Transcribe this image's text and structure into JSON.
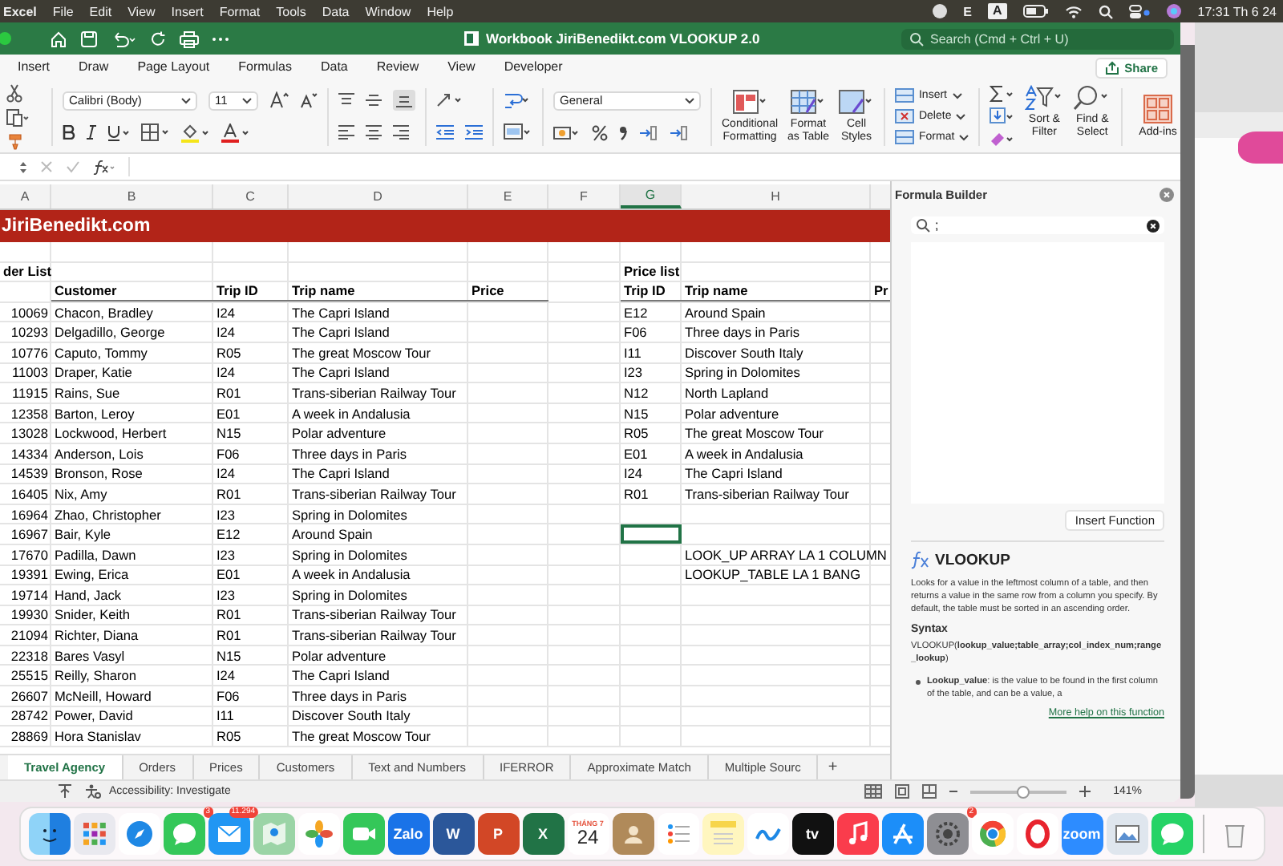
{
  "menu_bar": {
    "app": "Excel",
    "items": [
      "File",
      "Edit",
      "View",
      "Insert",
      "Format",
      "Tools",
      "Data",
      "Window",
      "Help"
    ],
    "status_items": [
      {
        "kind": "plain",
        "text": "E"
      },
      {
        "kind": "boxed",
        "text": "A"
      }
    ],
    "clock": "17:31 Th 6 24"
  },
  "window": {
    "title": "Workbook JiriBenedikt.com VLOOKUP 2.0",
    "search": {
      "placeholder": "Search (Cmd + Ctrl + U)"
    }
  },
  "ribbon": {
    "tabs": [
      {
        "label": "Insert",
        "selected": false
      },
      {
        "label": "Draw",
        "selected": false
      },
      {
        "label": "Page Layout",
        "selected": false
      },
      {
        "label": "Formulas",
        "selected": false
      },
      {
        "label": "Data",
        "selected": false
      },
      {
        "label": "Review",
        "selected": false
      },
      {
        "label": "View",
        "selected": false
      },
      {
        "label": "Developer",
        "selected": false
      }
    ],
    "share": "Share",
    "font": {
      "name": "Calibri (Body)",
      "size": "11"
    },
    "number_format": "General",
    "styles": [
      "Conditional\nFormatting",
      "Format\nas Table",
      "Cell\nStyles"
    ],
    "cells": [
      "Insert",
      "Delete",
      "Format"
    ],
    "editing": [
      "Sort &\nFilter",
      "Find &\nSelect"
    ],
    "add_ins": "Add-ins"
  },
  "sheet": {
    "columns": [
      {
        "label": "A",
        "selected": false
      },
      {
        "label": "B",
        "selected": false
      },
      {
        "label": "C",
        "selected": false
      },
      {
        "label": "D",
        "selected": false
      },
      {
        "label": "E",
        "selected": false
      },
      {
        "label": "F",
        "selected": false
      },
      {
        "label": "G",
        "selected": true
      },
      {
        "label": "H",
        "selected": false
      }
    ],
    "rows": [
      {
        "kind": "banner",
        "text": "JiriBenedikt.com",
        "selected": false
      },
      {
        "kind": "blank",
        "selected": false
      },
      {
        "kind": "title",
        "cells": {
          "A": "der List",
          "G": "Price list"
        },
        "selected": false
      },
      {
        "kind": "header",
        "cells": {
          "B": "Customer",
          "C": "Trip ID",
          "D": "Trip name",
          "E": "Price",
          "G": "Trip ID",
          "H": "Trip name",
          "I": "Pr"
        },
        "selected": false
      },
      {
        "kind": "data",
        "cells": {
          "A": "10069",
          "B": "Chacon, Bradley",
          "C": "I24",
          "D": "The Capri Island",
          "G": "E12",
          "H": "Around Spain"
        },
        "selected": false
      },
      {
        "kind": "data",
        "cells": {
          "A": "10293",
          "B": "Delgadillo, George",
          "C": "I24",
          "D": "The Capri Island",
          "G": "F06",
          "H": "Three days in Paris"
        },
        "selected": false
      },
      {
        "kind": "data",
        "cells": {
          "A": "10776",
          "B": "Caputo, Tommy",
          "C": "R05",
          "D": "The great Moscow Tour",
          "G": "I11",
          "H": "Discover South Italy"
        },
        "selected": false
      },
      {
        "kind": "data",
        "cells": {
          "A": "11003",
          "B": "Draper, Katie",
          "C": "I24",
          "D": "The Capri Island",
          "G": "I23",
          "H": "Spring in Dolomites"
        },
        "selected": false
      },
      {
        "kind": "data",
        "cells": {
          "A": "11915",
          "B": "Rains, Sue",
          "C": "R01",
          "D": "Trans-siberian Railway Tour",
          "G": "N12",
          "H": "North Lapland"
        },
        "selected": false
      },
      {
        "kind": "data",
        "cells": {
          "A": "12358",
          "B": "Barton, Leroy",
          "C": "E01",
          "D": "A week in Andalusia",
          "G": "N15",
          "H": "Polar adventure"
        },
        "selected": false
      },
      {
        "kind": "data",
        "cells": {
          "A": "13028",
          "B": "Lockwood, Herbert",
          "C": "N15",
          "D": "Polar adventure",
          "G": "R05",
          "H": "The great Moscow Tour"
        },
        "selected": false
      },
      {
        "kind": "data",
        "cells": {
          "A": "14334",
          "B": "Anderson, Lois",
          "C": "F06",
          "D": "Three days in Paris",
          "G": "E01",
          "H": "A week in Andalusia"
        },
        "selected": false
      },
      {
        "kind": "data",
        "cells": {
          "A": "14539",
          "B": "Bronson, Rose",
          "C": "I24",
          "D": "The Capri Island",
          "G": "I24",
          "H": "The Capri Island"
        },
        "selected": false
      },
      {
        "kind": "data",
        "cells": {
          "A": "16405",
          "B": "Nix, Amy",
          "C": "R01",
          "D": "Trans-siberian Railway Tour",
          "G": "R01",
          "H": "Trans-siberian Railway Tour"
        },
        "selected": false
      },
      {
        "kind": "data",
        "cells": {
          "A": "16964",
          "B": "Zhao, Christopher",
          "C": "I23",
          "D": "Spring in Dolomites"
        },
        "selected": false
      },
      {
        "kind": "data",
        "cells": {
          "A": "16967",
          "B": "Bair, Kyle",
          "C": "E12",
          "D": "Around Spain"
        },
        "selected": true
      },
      {
        "kind": "data",
        "cells": {
          "A": "17670",
          "B": "Padilla, Dawn",
          "C": "I23",
          "D": "Spring in Dolomites",
          "H": "LOOK_UP ARRAY LA 1 COLUMN"
        },
        "selected": false
      },
      {
        "kind": "data",
        "cells": {
          "A": "19391",
          "B": "Ewing, Erica",
          "C": "E01",
          "D": "A week in Andalusia",
          "H": "LOOKUP_TABLE LA 1 BANG"
        },
        "selected": false
      },
      {
        "kind": "data",
        "cells": {
          "A": "19714",
          "B": "Hand, Jack",
          "C": "I23",
          "D": "Spring in Dolomites"
        },
        "selected": false
      },
      {
        "kind": "data",
        "cells": {
          "A": "19930",
          "B": "Snider, Keith",
          "C": "R01",
          "D": "Trans-siberian Railway Tour"
        },
        "selected": false
      },
      {
        "kind": "data",
        "cells": {
          "A": "21094",
          "B": "Richter, Diana",
          "C": "R01",
          "D": "Trans-siberian Railway Tour"
        },
        "selected": false
      },
      {
        "kind": "data",
        "cells": {
          "A": "22318",
          "B": "Bares Vasyl",
          "C": "N15",
          "D": "Polar adventure"
        },
        "selected": false
      },
      {
        "kind": "data",
        "cells": {
          "A": "25515",
          "B": "Reilly, Sharon",
          "C": "I24",
          "D": "The Capri Island"
        },
        "selected": false
      },
      {
        "kind": "data",
        "cells": {
          "A": "26607",
          "B": "McNeill, Howard",
          "C": "F06",
          "D": "Three days in Paris"
        },
        "selected": false
      },
      {
        "kind": "data",
        "cells": {
          "A": "28742",
          "B": "Power, David",
          "C": "I11",
          "D": "Discover South Italy"
        },
        "selected": false
      },
      {
        "kind": "data",
        "cells": {
          "A": "28869",
          "B": "Hora Stanislav",
          "C": "R05",
          "D": "The great Moscow Tour"
        },
        "selected": false
      }
    ]
  },
  "sheet_tabs": [
    {
      "label": "Travel Agency",
      "selected": true
    },
    {
      "label": "Orders",
      "selected": false
    },
    {
      "label": "Prices",
      "selected": false
    },
    {
      "label": "Customers",
      "selected": false
    },
    {
      "label": "Text and Numbers",
      "selected": false
    },
    {
      "label": "IFERROR",
      "selected": false
    },
    {
      "label": "Approximate Match",
      "selected": false
    },
    {
      "label": "Multiple Sourc",
      "selected": false
    }
  ],
  "add_sheet": "+",
  "formula_builder": {
    "title": "Formula Builder",
    "search": {
      "value": ";"
    },
    "insert_button": "Insert Function",
    "function": {
      "name": "VLOOKUP",
      "description": "Looks for a value in the leftmost column of a table, and then returns a value in the same row from a column you specify. By default, the table must be sorted in an ascending order.",
      "syntax_heading": "Syntax",
      "syntax": "VLOOKUP(**lookup_value;table_array;col_index_num;range_lookup**)",
      "arguments": [
        "**Lookup_value**: is the value to be found in the first column of the table, and can be a value, a"
      ]
    },
    "help_link": "More help on this function"
  },
  "status_bar": {
    "accessibility": "Accessibility: Investigate",
    "zoom_slider": {
      "level": 0.55
    },
    "zoom": "141%"
  },
  "dock": {
    "items": [
      {
        "kind": "finder"
      },
      {
        "kind": "launchpad"
      },
      {
        "kind": "safari"
      },
      {
        "kind": "messages",
        "badge": "3"
      },
      {
        "kind": "mail",
        "badge": "11.294"
      },
      {
        "kind": "maps"
      },
      {
        "kind": "photos"
      },
      {
        "kind": "facetime"
      },
      {
        "kind": "zalo",
        "label": "Zalo"
      },
      {
        "kind": "word",
        "label": "W"
      },
      {
        "kind": "powerpoint",
        "label": "P"
      },
      {
        "kind": "excel",
        "label": "X"
      },
      {
        "kind": "calendar",
        "month": "THÁNG 7",
        "day": "24"
      },
      {
        "kind": "contacts"
      },
      {
        "kind": "reminders"
      },
      {
        "kind": "notes"
      },
      {
        "kind": "freeform"
      },
      {
        "kind": "tv",
        "label": "tv"
      },
      {
        "kind": "music"
      },
      {
        "kind": "appstore"
      },
      {
        "kind": "settings",
        "badge": "2"
      },
      {
        "kind": "chrome"
      },
      {
        "kind": "opera"
      },
      {
        "kind": "zoom",
        "label": "zoom"
      },
      {
        "kind": "preview"
      },
      {
        "kind": "whatsapp"
      },
      {
        "kind": "trash"
      }
    ]
  }
}
